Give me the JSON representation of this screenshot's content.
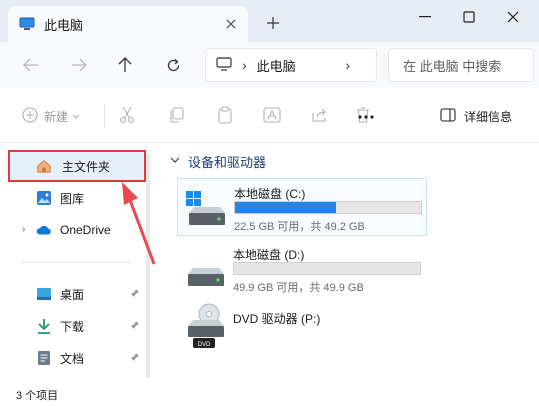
{
  "tab": {
    "title": "此电脑",
    "close_icon": "close-icon",
    "new_tab_icon": "plus-icon"
  },
  "window_controls": {
    "minimize": "minimize-icon",
    "maximize": "maximize-icon",
    "close": "close-icon"
  },
  "nav": {
    "back": "arrow-left-icon",
    "forward": "arrow-right-icon",
    "up": "arrow-up-icon",
    "refresh": "refresh-icon"
  },
  "address": {
    "location": "此电脑",
    "icon": "computer-icon"
  },
  "search": {
    "placeholder": "在 此电脑 中搜索"
  },
  "toolbar": {
    "new_label": "新建",
    "details_label": "详细信息",
    "more_icon": "more-icon"
  },
  "sidebar": {
    "items": [
      {
        "label": "主文件夹",
        "icon": "home-icon",
        "selected": true
      },
      {
        "label": "图库",
        "icon": "gallery-icon"
      },
      {
        "label": "OneDrive",
        "icon": "cloud-icon"
      },
      {
        "label": "桌面",
        "icon": "desktop-icon",
        "pinned": true
      },
      {
        "label": "下载",
        "icon": "download-icon",
        "pinned": true
      },
      {
        "label": "文档",
        "icon": "document-icon",
        "pinned": true
      }
    ]
  },
  "main": {
    "section_title": "设备和驱动器",
    "drives": [
      {
        "name": "本地磁盘 (C:)",
        "info": "22.5 GB 可用，共 49.2 GB",
        "used_fraction": 0.543,
        "fill_color": "#2386e4",
        "has_windows_logo": true
      },
      {
        "name": "本地磁盘 (D:)",
        "info": "49.9 GB 可用，共 49.9 GB",
        "used_fraction": 0.0
      },
      {
        "name": "DVD 驱动器 (P:)",
        "disc_label": "DVD"
      }
    ]
  },
  "status": {
    "text": "3 个项目"
  },
  "colors": {
    "accent": "#2386e4",
    "highlight_border": "#e03a3a",
    "selected_bg": "#e5f0fb"
  }
}
